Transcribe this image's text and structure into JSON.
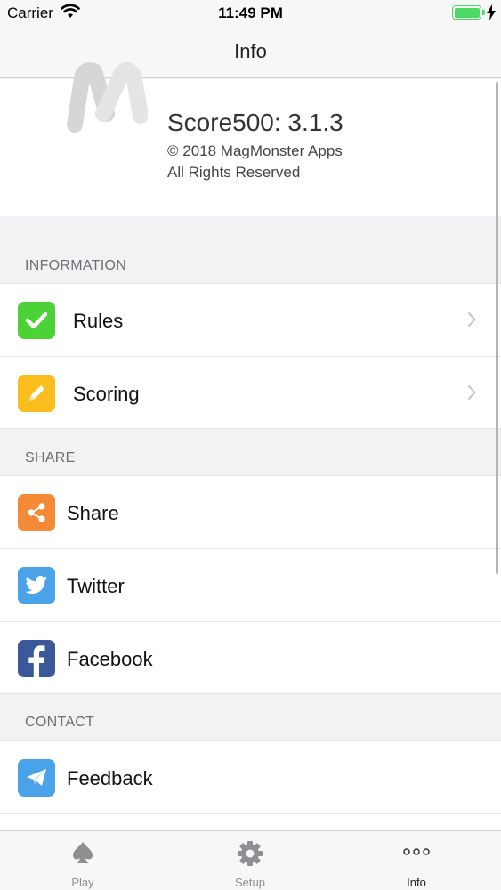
{
  "status_bar": {
    "carrier": "Carrier",
    "time": "11:49 PM"
  },
  "nav": {
    "title": "Info"
  },
  "app_info": {
    "name": "Score500: 3.1.3",
    "copyright": "© 2018 MagMonster Apps",
    "rights": "All Rights Reserved"
  },
  "sections": {
    "information": "INFORMATION",
    "share": "SHARE",
    "contact": "CONTACT"
  },
  "rows": {
    "rules": {
      "label": "Rules",
      "icon": "checkmark-icon",
      "color": "#4cd137"
    },
    "scoring": {
      "label": "Scoring",
      "icon": "pencil-icon",
      "color": "#fbbd1b"
    },
    "share": {
      "label": "Share",
      "icon": "share-icon",
      "color": "#f48a35"
    },
    "twitter": {
      "label": "Twitter",
      "icon": "twitter-bird-icon",
      "color": "#4aa3e8"
    },
    "facebook": {
      "label": "Facebook",
      "icon": "facebook-f-icon",
      "color": "#3b5998"
    },
    "feedback": {
      "label": "Feedback",
      "icon": "paper-plane-icon",
      "color": "#4aa3e8"
    }
  },
  "tabs": [
    {
      "label": "Play",
      "icon": "spade-icon"
    },
    {
      "label": "Setup",
      "icon": "gear-icon"
    },
    {
      "label": "Info",
      "icon": "more-dots-icon",
      "active": true
    }
  ]
}
